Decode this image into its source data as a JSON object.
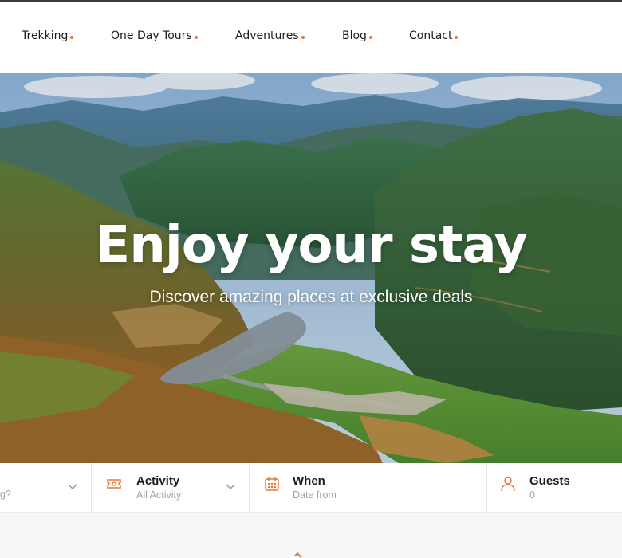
{
  "nav": {
    "items": [
      {
        "label": "Trekking"
      },
      {
        "label": "One Day Tours"
      },
      {
        "label": "Adventures"
      },
      {
        "label": "Blog"
      },
      {
        "label": "Contact"
      }
    ]
  },
  "hero": {
    "title": "Enjoy your stay",
    "subtitle": "Discover amazing places at exclusive deals"
  },
  "search": {
    "destination": {
      "value": "g?",
      "icon": "chevron-down-icon"
    },
    "activity": {
      "label": "Activity",
      "value": "All Activity",
      "icon": "ticket-icon"
    },
    "when": {
      "label": "When",
      "value": "Date from",
      "icon": "calendar-icon"
    },
    "guests": {
      "label": "Guests",
      "value": "0",
      "icon": "user-icon"
    }
  },
  "colors": {
    "accent": "#e8763a",
    "text": "#1c1c1c",
    "muted": "#a3a3a3"
  }
}
